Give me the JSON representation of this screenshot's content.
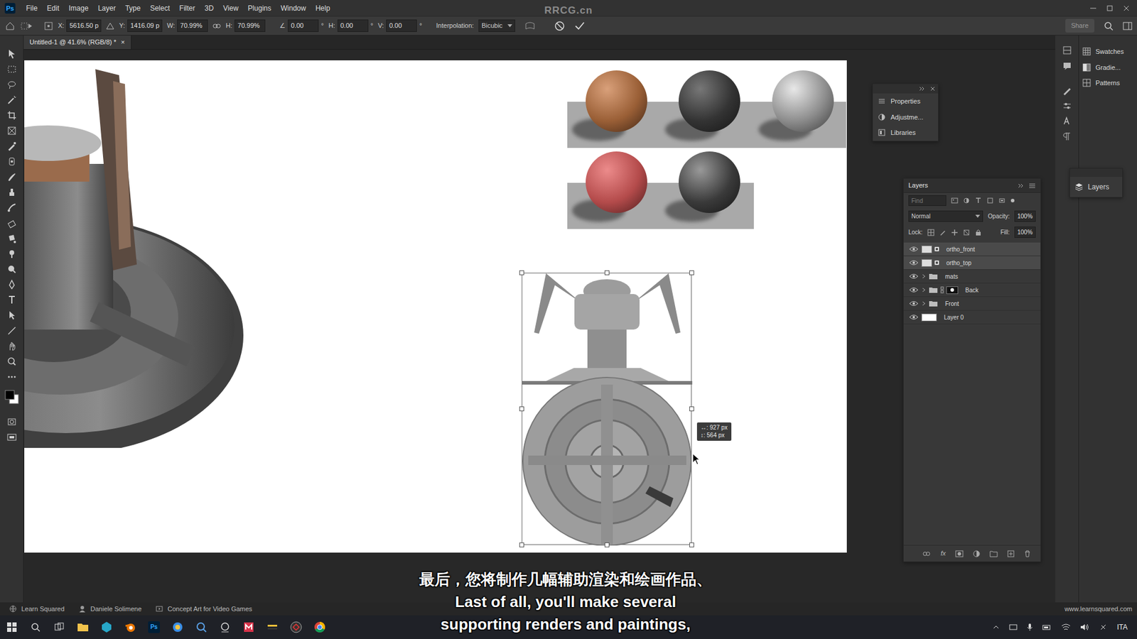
{
  "menubar": {
    "logo": "Ps",
    "items": [
      "File",
      "Edit",
      "Image",
      "Layer",
      "Type",
      "Select",
      "Filter",
      "3D",
      "View",
      "Plugins",
      "Window",
      "Help"
    ],
    "watermark": "RRCG.cn"
  },
  "options": {
    "fields": [
      {
        "label": "X:",
        "value": "5616.50 p"
      },
      {
        "label": "Y:",
        "value": "1416.09 p"
      },
      {
        "label": "W:",
        "value": "70.99%"
      },
      {
        "label": "H:",
        "value": "70.99%"
      },
      {
        "label": "∠",
        "value": "0.00",
        "unit": "°"
      },
      {
        "label": "H:",
        "value": "0.00",
        "unit": "°"
      },
      {
        "label": "V:",
        "value": "0.00",
        "unit": "°"
      }
    ],
    "interpolation_label": "Interpolation:",
    "interpolation": "Bicubic",
    "share": "Share"
  },
  "document_tab": {
    "title": "Untitled-1 @ 41.6% (RGB/8) *",
    "close": "×"
  },
  "canvas": {
    "tooltip": [
      "↔: 927 px",
      "↕: 564 px"
    ]
  },
  "floating_panel": {
    "items": [
      "Properties",
      "Adjustme...",
      "Libraries"
    ]
  },
  "dock_panel": {
    "items": [
      "Swatches",
      "Gradie...",
      "Patterns"
    ]
  },
  "layers_collapsed": "Layers",
  "layers": {
    "title": "Layers",
    "search_placeholder": "Find",
    "blend_mode": "Normal",
    "opacity_label": "Opacity:",
    "opacity": "100%",
    "lock_label": "Lock:",
    "fill_label": "Fill:",
    "fill": "100%",
    "fx": "fx",
    "rows": [
      {
        "name": "ortho_front",
        "kind": "smart",
        "visible": true,
        "selected": true
      },
      {
        "name": "ortho_top",
        "kind": "smart",
        "visible": true,
        "selected": true
      },
      {
        "name": "mats",
        "kind": "group",
        "visible": true,
        "selected": false
      },
      {
        "name": "Back",
        "kind": "masked",
        "visible": true,
        "selected": false
      },
      {
        "name": "Front",
        "kind": "group",
        "visible": true,
        "selected": false
      },
      {
        "name": "Layer 0",
        "kind": "pixel",
        "visible": true,
        "selected": false
      }
    ]
  },
  "status_bar": {
    "left": [
      "Learn Squared",
      "Daniele Solimene",
      "Concept Art for Video Games"
    ],
    "right": "www.learnsquared.com"
  },
  "subtitles": [
    "最后，您将制作几幅辅助渲染和绘画作品、",
    "Last of all, you'll make several",
    "supporting renders and paintings,"
  ],
  "taskbar": {
    "ps_label": "Ps",
    "language": "ITA"
  }
}
